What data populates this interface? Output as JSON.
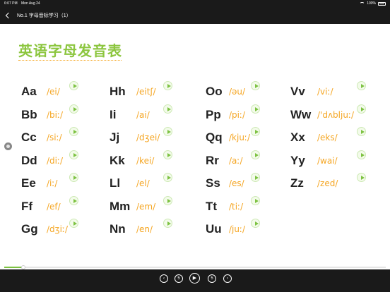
{
  "status_bar": {
    "time": "6:07 PM",
    "date": "Mon Aug 24",
    "battery": "100%"
  },
  "nav": {
    "title": "No.1 字母音标学习（1）"
  },
  "heading": "英语字母发音表",
  "columns": [
    [
      {
        "letter": "Aa",
        "ipa": "/ei/"
      },
      {
        "letter": "Bb",
        "ipa": "/biː/"
      },
      {
        "letter": "Cc",
        "ipa": "/siː/"
      },
      {
        "letter": "Dd",
        "ipa": "/diː/"
      },
      {
        "letter": "Ee",
        "ipa": "/iː/"
      },
      {
        "letter": "Ff",
        "ipa": "/ef/"
      },
      {
        "letter": "Gg",
        "ipa": "/dʒiː/"
      }
    ],
    [
      {
        "letter": "Hh",
        "ipa": "/eitʃ/"
      },
      {
        "letter": "Ii",
        "ipa": "/ai/"
      },
      {
        "letter": "Jj",
        "ipa": "/dʒei/"
      },
      {
        "letter": "Kk",
        "ipa": "/kei/"
      },
      {
        "letter": "Ll",
        "ipa": "/el/"
      },
      {
        "letter": "Mm",
        "ipa": "/em/"
      },
      {
        "letter": "Nn",
        "ipa": "/en/"
      }
    ],
    [
      {
        "letter": "Oo",
        "ipa": "/əu/"
      },
      {
        "letter": "Pp",
        "ipa": "/piː/"
      },
      {
        "letter": "Qq",
        "ipa": "/kjuː/"
      },
      {
        "letter": "Rr",
        "ipa": "/aː/"
      },
      {
        "letter": "Ss",
        "ipa": "/es/"
      },
      {
        "letter": "Tt",
        "ipa": "/tiː/"
      },
      {
        "letter": "Uu",
        "ipa": "/juː/"
      }
    ],
    [
      {
        "letter": "Vv",
        "ipa": "/viː/"
      },
      {
        "letter": "Ww",
        "ipa": "/'dʌbljuː/"
      },
      {
        "letter": "Xx",
        "ipa": "/eks/"
      },
      {
        "letter": "Yy",
        "ipa": "/wai/"
      },
      {
        "letter": "Zz",
        "ipa": "/zed/"
      }
    ]
  ],
  "icons": {
    "play": "play-circle-icon",
    "side": "audio-toggle-icon"
  },
  "colors": {
    "accent_green": "#8cc63f",
    "ipa_orange": "#f5a623",
    "bar_bg": "#1a1a1a"
  },
  "playback": {
    "progress": 0.05
  },
  "controls": [
    {
      "name": "previous-button",
      "glyph": "‹"
    },
    {
      "name": "rewind-5-button",
      "glyph": "5"
    },
    {
      "name": "play-pause-button",
      "glyph": "▶"
    },
    {
      "name": "forward-5-button",
      "glyph": "5"
    },
    {
      "name": "next-button",
      "glyph": "›"
    }
  ]
}
